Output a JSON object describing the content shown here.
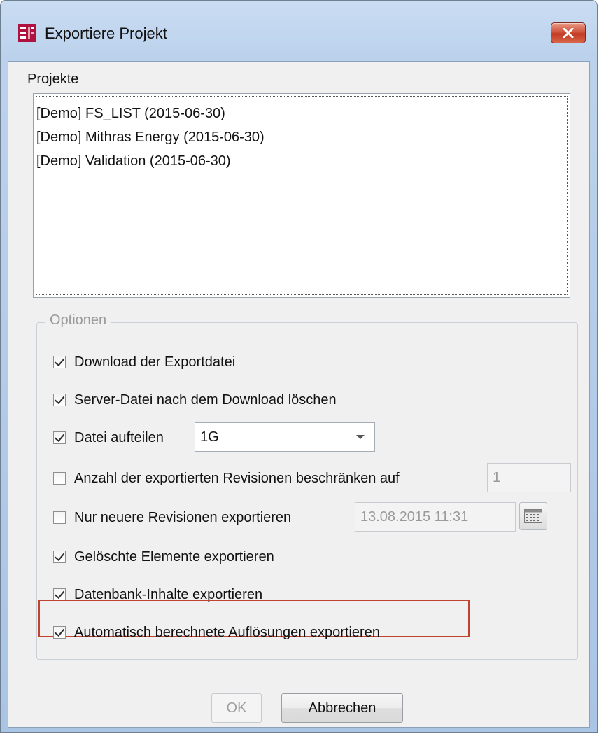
{
  "window": {
    "title": "Exportiere Projekt",
    "close_glyph": "✕"
  },
  "projects": {
    "label": "Projekte",
    "items": [
      "[Demo] FS_LIST (2015-06-30)",
      "[Demo] Mithras Energy (2015-06-30)",
      "[Demo] Validation (2015-06-30)"
    ]
  },
  "options": {
    "legend": "Optionen",
    "download": {
      "label": "Download der Exportdatei",
      "checked": true
    },
    "delete_server_file": {
      "label": "Server-Datei nach dem Download löschen",
      "checked": true
    },
    "split_file": {
      "label": "Datei aufteilen",
      "checked": true,
      "value": "1G"
    },
    "limit_revisions": {
      "label": "Anzahl der exportierten Revisionen beschränken auf",
      "checked": false,
      "value": "1"
    },
    "newer_revisions": {
      "label": "Nur neuere Revisionen exportieren",
      "checked": false,
      "value": "13.08.2015 11:31"
    },
    "deleted_elements": {
      "label": "Gelöschte Elemente exportieren",
      "checked": true
    },
    "database_content": {
      "label": "Datenbank-Inhalte exportieren",
      "checked": true
    },
    "auto_resolutions": {
      "label": "Automatisch berechnete Auflösungen exportieren",
      "checked": true
    }
  },
  "buttons": {
    "ok": "OK",
    "cancel": "Abbrechen"
  },
  "colors": {
    "highlight": "#c0432f",
    "app_icon": "#b0123f"
  },
  "icons": {
    "app": "firstspirit-logo-icon",
    "close": "close-icon",
    "dropdown": "chevron-down-icon",
    "calendar": "calendar-icon"
  }
}
